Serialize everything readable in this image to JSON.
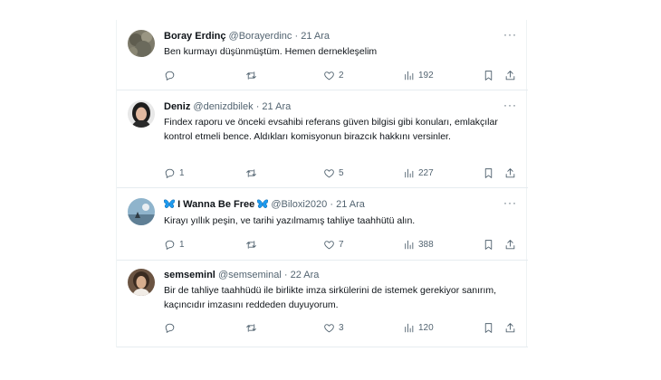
{
  "tweets": [
    {
      "name": "Boray Erdinç",
      "handle": "@Borayerdinc",
      "separator": "·",
      "time": "21 Ara",
      "text": "Ben kurmayı düşünmüştüm. Hemen dernekleşelim",
      "replies": "",
      "retweets": "",
      "likes": "2",
      "views": "192"
    },
    {
      "name": "Deniz",
      "handle": "@denizdbilek",
      "separator": "·",
      "time": "21 Ara",
      "text": "Findex raporu ve önceki evsahibi referans güven bilgisi gibi konuları, emlakçılar kontrol etmeli bence. Aldıkları komisyonun birazcık hakkını versinler.",
      "replies": "1",
      "retweets": "",
      "likes": "5",
      "views": "227"
    },
    {
      "name": "I Wanna Be Free",
      "handle": "@Biloxi2020",
      "separator": "·",
      "time": "21 Ara",
      "text": "Kirayı yıllık peşin, ve tarihi yazılmamış tahliye taahhütü alın.",
      "replies": "1",
      "retweets": "",
      "likes": "7",
      "views": "388"
    },
    {
      "name": "semseminl",
      "handle": "@semseminal",
      "separator": "·",
      "time": "22 Ara",
      "text": "Bir de tahliye taahhüdü ile birlikte imza sirkülerini de istemek gerekiyor sanırım, kaçıncıdır imzasını reddeden duyuyorum.",
      "replies": "",
      "retweets": "",
      "likes": "3",
      "views": "120"
    }
  ],
  "icons": {
    "more": "more-icon",
    "reply": "reply-icon",
    "retweet": "retweet-icon",
    "like": "heart-icon",
    "views": "views-icon",
    "bookmark": "bookmark-icon",
    "share": "share-icon",
    "butterfly": "butterfly-emoji-icon"
  },
  "colors": {
    "text": "#0f1419",
    "secondary": "#536471",
    "divider": "#e6ecf0",
    "butterfly": "#1d9bf0"
  }
}
